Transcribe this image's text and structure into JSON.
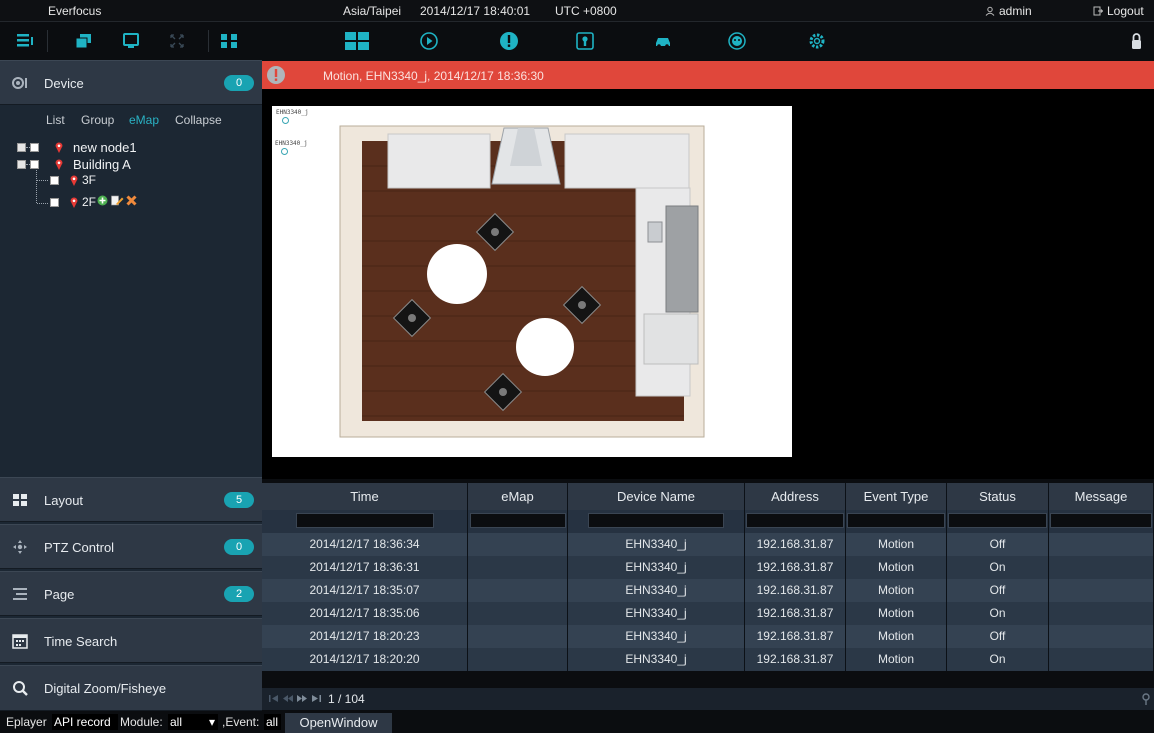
{
  "titlebar": {
    "app_name": "Everfocus",
    "timezone": "Asia/Taipei",
    "datetime": "2014/12/17 18:40:01",
    "utc": "UTC +0800",
    "user": "admin",
    "logout": "Logout"
  },
  "toolbar": {
    "left_icons": [
      "list-view-icon",
      "window-icon",
      "monitor-icon",
      "fullscreen-icon",
      "split-layout-icon"
    ],
    "center_icons": [
      "live-grid-icon",
      "playback-icon",
      "alarm-icon",
      "event-log-icon",
      "car-lpr-icon",
      "face-icon",
      "settings-icon"
    ],
    "right_icons": [
      "lock-icon"
    ]
  },
  "alarm": {
    "text": "Motion, EHN3340_j, 2014/12/17 18:36:30",
    "color": "#e0473b"
  },
  "sidebar": {
    "device": {
      "label": "Device",
      "badge": "0"
    },
    "tabs": [
      "List",
      "Group",
      "eMap",
      "Collapse"
    ],
    "active_tab": "eMap",
    "tree": {
      "node1": "new node1",
      "node2": "Building A",
      "child1": "3F",
      "child2": "2F"
    },
    "layout": {
      "label": "Layout",
      "badge": "5"
    },
    "ptz": {
      "label": "PTZ Control",
      "badge": "0"
    },
    "page": {
      "label": "Page",
      "badge": "2"
    },
    "time_search": {
      "label": "Time Search"
    },
    "digital_zoom": {
      "label": "Digital Zoom/Fisheye"
    }
  },
  "emap": {
    "camera_labels": [
      "EHN3340_j",
      "EHN3340_j"
    ]
  },
  "events": {
    "columns": [
      "Time",
      "eMap",
      "Device Name",
      "Address",
      "Event Type",
      "Status",
      "Message"
    ],
    "rows": [
      [
        "2014/12/17 18:36:34",
        "",
        "EHN3340_j",
        "192.168.31.87",
        "Motion",
        "Off",
        ""
      ],
      [
        "2014/12/17 18:36:31",
        "",
        "EHN3340_j",
        "192.168.31.87",
        "Motion",
        "On",
        ""
      ],
      [
        "2014/12/17 18:35:07",
        "",
        "EHN3340_j",
        "192.168.31.87",
        "Motion",
        "Off",
        ""
      ],
      [
        "2014/12/17 18:35:06",
        "",
        "EHN3340_j",
        "192.168.31.87",
        "Motion",
        "On",
        ""
      ],
      [
        "2014/12/17 18:20:23",
        "",
        "EHN3340_j",
        "192.168.31.87",
        "Motion",
        "Off",
        ""
      ],
      [
        "2014/12/17 18:20:20",
        "",
        "EHN3340_j",
        "192.168.31.87",
        "Motion",
        "On",
        ""
      ]
    ],
    "page_info": "1 / 104"
  },
  "bottombar": {
    "eplayer": "Eplayer",
    "api_select": "API record",
    "module_label": "Module:",
    "module_value": "all",
    "event_label": ",Event:",
    "event_value": "all",
    "open_window": "OpenWindow"
  },
  "colors": {
    "accent": "#19a3b2",
    "panel": "#2e3845",
    "alarm": "#e0473b"
  }
}
